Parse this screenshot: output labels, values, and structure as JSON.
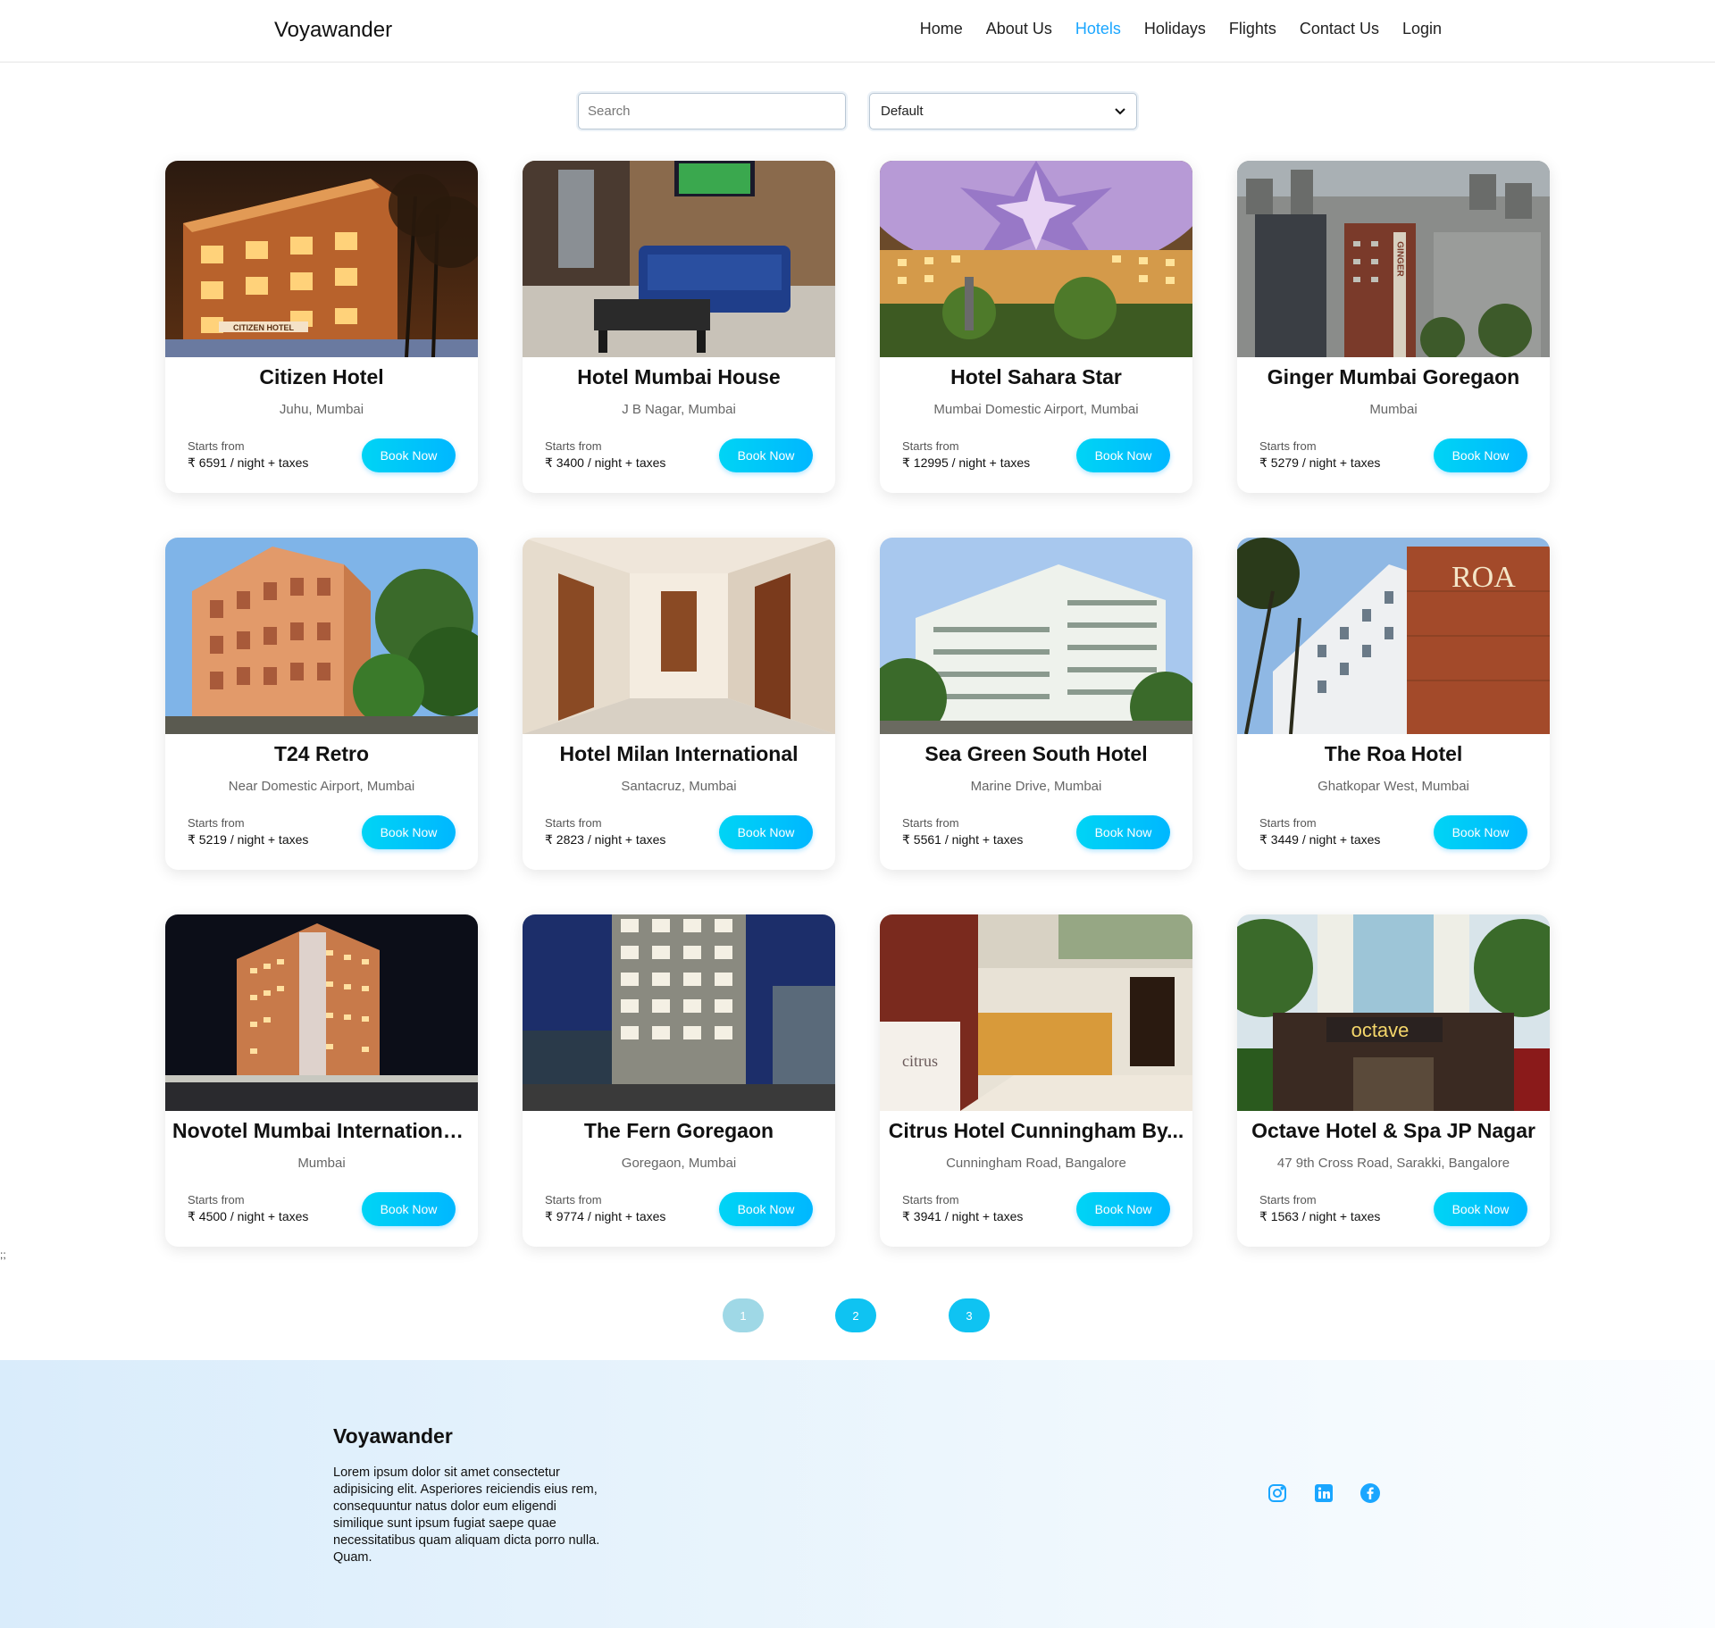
{
  "nav": {
    "brand": "Voyawander",
    "links": [
      {
        "label": "Home",
        "active": false
      },
      {
        "label": "About Us",
        "active": false
      },
      {
        "label": "Hotels",
        "active": true
      },
      {
        "label": "Holidays",
        "active": false
      },
      {
        "label": "Flights",
        "active": false
      },
      {
        "label": "Contact Us",
        "active": false
      },
      {
        "label": "Login",
        "active": false
      }
    ],
    "active_color": "#1aa6ff"
  },
  "search": {
    "placeholder": "Search",
    "value": "",
    "sort_selected": "Default"
  },
  "hotels": [
    {
      "name": "Citizen Hotel",
      "location": "Juhu, Mumbai",
      "price_label": "Starts from",
      "price": "₹ 6591 / night + taxes",
      "button": "Book Now"
    },
    {
      "name": "Hotel Mumbai House",
      "location": "J B Nagar, Mumbai",
      "price_label": "Starts from",
      "price": "₹ 3400 / night + taxes",
      "button": "Book Now"
    },
    {
      "name": "Hotel Sahara Star",
      "location": "Mumbai Domestic Airport, Mumbai",
      "price_label": "Starts from",
      "price": "₹ 12995 / night + taxes",
      "button": "Book Now"
    },
    {
      "name": "Ginger Mumbai Goregaon",
      "location": "Mumbai",
      "price_label": "Starts from",
      "price": "₹ 5279 / night + taxes",
      "button": "Book Now"
    },
    {
      "name": "T24 Retro",
      "location": "Near Domestic Airport, Mumbai",
      "price_label": "Starts from",
      "price": "₹ 5219 / night + taxes",
      "button": "Book Now"
    },
    {
      "name": "Hotel Milan International",
      "location": "Santacruz, Mumbai",
      "price_label": "Starts from",
      "price": "₹ 2823 / night + taxes",
      "button": "Book Now"
    },
    {
      "name": "Sea Green South Hotel",
      "location": "Marine Drive, Mumbai",
      "price_label": "Starts from",
      "price": "₹ 5561 / night + taxes",
      "button": "Book Now"
    },
    {
      "name": "The Roa Hotel",
      "location": "Ghatkopar West, Mumbai",
      "price_label": "Starts from",
      "price": "₹ 3449 / night + taxes",
      "button": "Book Now"
    },
    {
      "name": "Novotel Mumbai International...",
      "location": "Mumbai",
      "price_label": "Starts from",
      "price": "₹ 4500 / night + taxes",
      "button": "Book Now"
    },
    {
      "name": "The Fern Goregaon",
      "location": "Goregaon, Mumbai",
      "price_label": "Starts from",
      "price": "₹ 9774 / night + taxes",
      "button": "Book Now"
    },
    {
      "name": "Citrus Hotel Cunningham By...",
      "location": "Cunningham Road, Bangalore",
      "price_label": "Starts from",
      "price": "₹ 3941 / night + taxes",
      "button": "Book Now"
    },
    {
      "name": "Octave Hotel & Spa JP Nagar",
      "location": "47 9th Cross Road, Sarakki, Bangalore",
      "price_label": "Starts from",
      "price": "₹ 1563 / night + taxes",
      "button": "Book Now"
    }
  ],
  "image_signage": {
    "citizen": "CITIZEN HOTEL",
    "ginger": "GINGER",
    "roa": "ROA",
    "citrus": "citrus",
    "octave": "octave"
  },
  "pagination": {
    "pages": [
      "1",
      "2",
      "3"
    ],
    "current": "1"
  },
  "stray_text": ";;",
  "footer": {
    "brand": "Voyawander",
    "text": "Lorem ipsum dolor sit amet consectetur adipisicing elit. Asperiores reiciendis eius rem, consequuntur natus dolor eum eligendi similique sunt ipsum fugiat saepe quae necessitatibus quam aliquam dicta porro nulla. Quam.",
    "socials": [
      "instagram-icon",
      "linkedin-icon",
      "facebook-icon"
    ],
    "icon_color": "#1aa6ff"
  }
}
